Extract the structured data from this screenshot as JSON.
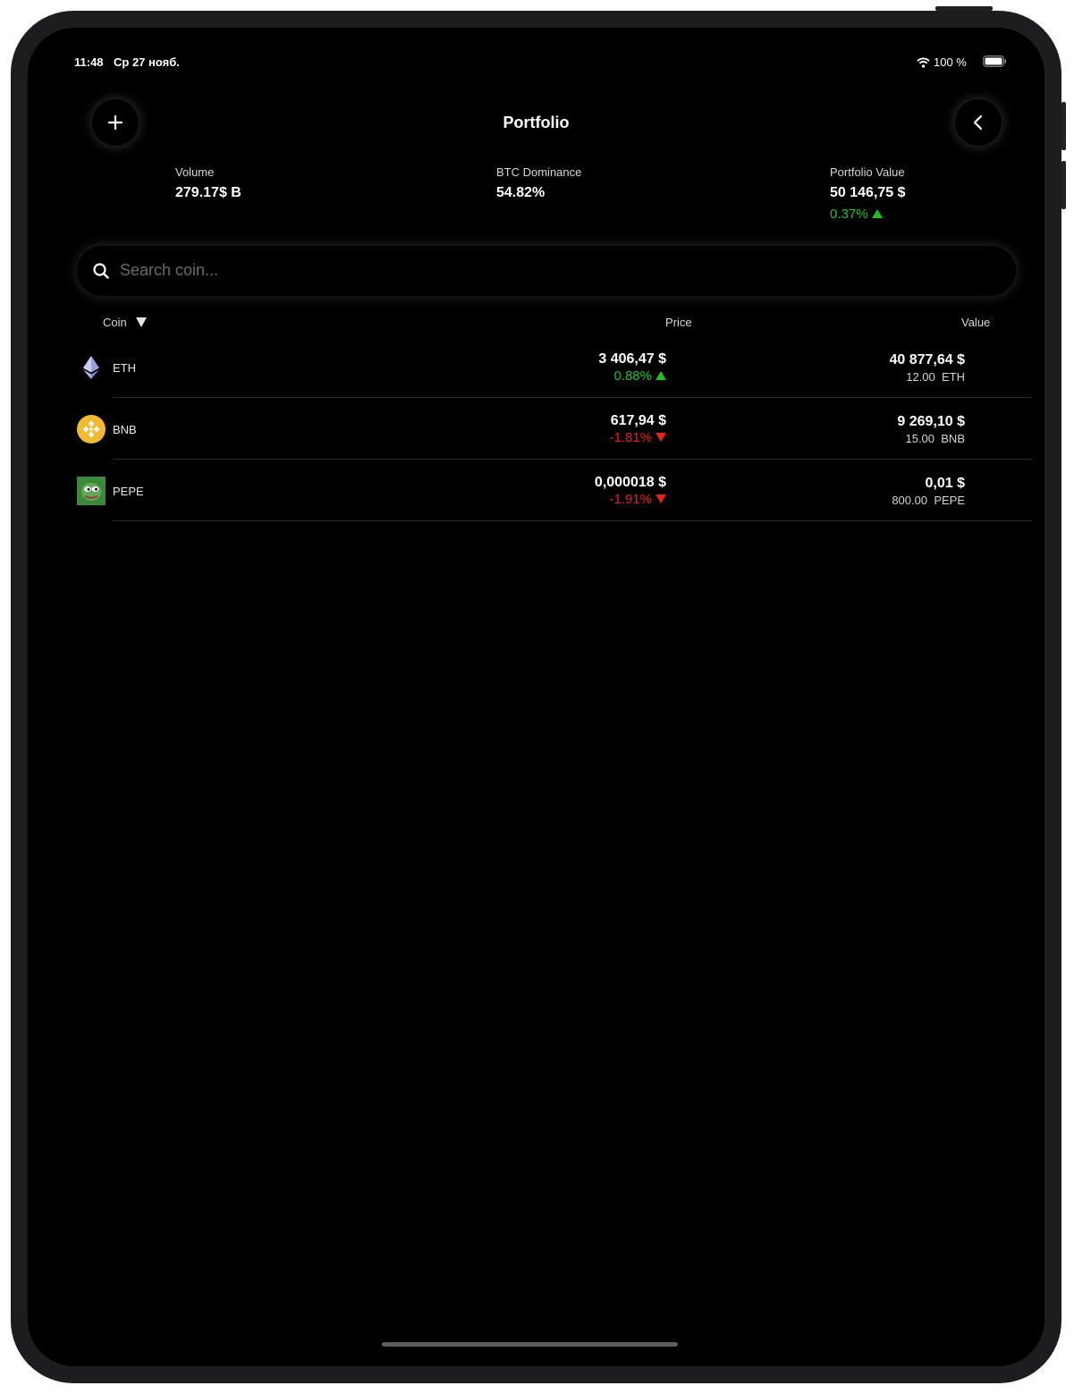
{
  "status_bar": {
    "time": "11:48",
    "date": "Ср 27 нояб.",
    "battery": "100 %"
  },
  "header": {
    "title": "Portfolio"
  },
  "stats": {
    "volume": {
      "label": "Volume",
      "value": "279.17$ B"
    },
    "btc_dominance": {
      "label": "BTC Dominance",
      "value": "54.82%"
    },
    "portfolio_value": {
      "label": "Portfolio Value",
      "value": "50 146,75 $",
      "change": "0.37%",
      "direction": "up"
    }
  },
  "search": {
    "placeholder": "Search coin..."
  },
  "columns": {
    "coin": "Coin",
    "price": "Price",
    "value": "Value"
  },
  "coins": [
    {
      "symbol": "ETH",
      "icon": "ethereum-icon",
      "price": "3 406,47 $",
      "change": "0.88%",
      "direction": "up",
      "value": "40 877,64 $",
      "amount": "12.00",
      "unit": "ETH"
    },
    {
      "symbol": "BNB",
      "icon": "bnb-icon",
      "price": "617,94 $",
      "change": "-1.81%",
      "direction": "down",
      "value": "9 269,10 $",
      "amount": "15.00",
      "unit": "BNB"
    },
    {
      "symbol": "PEPE",
      "icon": "pepe-icon",
      "price": "0,000018 $",
      "change": "-1.91%",
      "direction": "down",
      "value": "0,01 $",
      "amount": "800.00",
      "unit": "PEPE"
    }
  ],
  "colors": {
    "up": "#21c21f",
    "down": "#e4211b",
    "background": "#000000"
  }
}
